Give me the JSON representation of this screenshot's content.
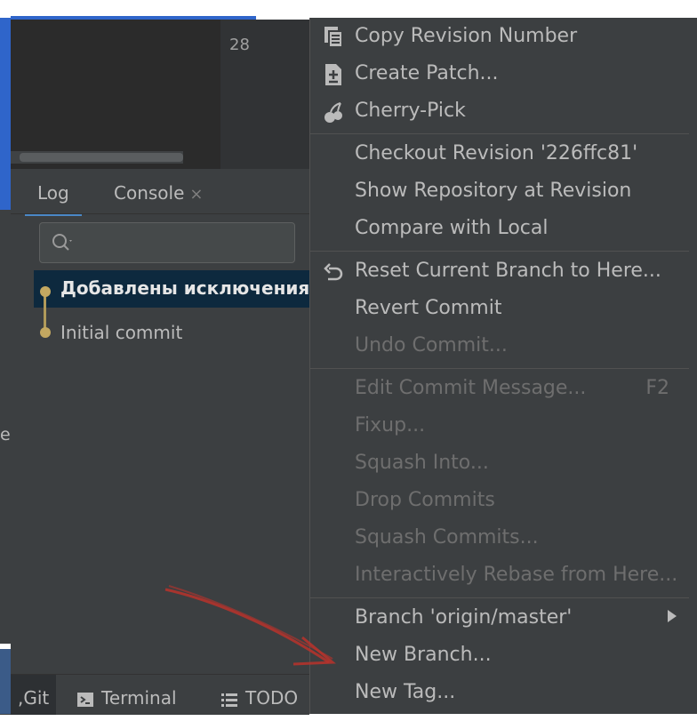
{
  "editor": {
    "line_number": "28"
  },
  "tool_window": {
    "tabs": [
      {
        "label": "Log"
      },
      {
        "label": "Console",
        "close": "×"
      }
    ],
    "search": {
      "placeholder": ""
    },
    "commits": [
      {
        "message": "Добавлены исключения"
      },
      {
        "message": "Initial commit"
      }
    ],
    "left_partial_text": "er"
  },
  "bottom_bar": {
    "tabs": [
      {
        "label": "Git",
        "prefix": ","
      },
      {
        "label": "Terminal",
        "icon": "terminal-icon"
      },
      {
        "label": "TODO",
        "icon": "list-icon"
      }
    ]
  },
  "context_menu": {
    "items": [
      {
        "label": "Copy Revision Number",
        "icon": "copy-icon",
        "enabled": true
      },
      {
        "label": "Create Patch...",
        "icon": "patch-icon",
        "enabled": true
      },
      {
        "label": "Cherry-Pick",
        "icon": "cherry-icon",
        "enabled": true
      },
      {
        "label": "Checkout Revision '226ffc81'",
        "enabled": true
      },
      {
        "label": "Show Repository at Revision",
        "enabled": true
      },
      {
        "label": "Compare with Local",
        "enabled": true
      },
      {
        "label": "Reset Current Branch to Here...",
        "icon": "undo-icon",
        "enabled": true
      },
      {
        "label": "Revert Commit",
        "enabled": true
      },
      {
        "label": "Undo Commit...",
        "enabled": false
      },
      {
        "label": "Edit Commit Message...",
        "shortcut": "F2",
        "enabled": false
      },
      {
        "label": "Fixup...",
        "enabled": false
      },
      {
        "label": "Squash Into...",
        "enabled": false
      },
      {
        "label": "Drop Commits",
        "enabled": false
      },
      {
        "label": "Squash Commits...",
        "enabled": false
      },
      {
        "label": "Interactively Rebase from Here...",
        "enabled": false
      },
      {
        "label": "Branch 'origin/master'",
        "submenu": true,
        "enabled": true
      },
      {
        "label": "New Branch...",
        "enabled": true
      },
      {
        "label": "New Tag...",
        "enabled": true
      }
    ]
  },
  "colors": {
    "accent_blue": "#2f65ca",
    "selection": "#0d293e",
    "graph": "#c3a861",
    "annotation_arrow": "#c0392b"
  }
}
